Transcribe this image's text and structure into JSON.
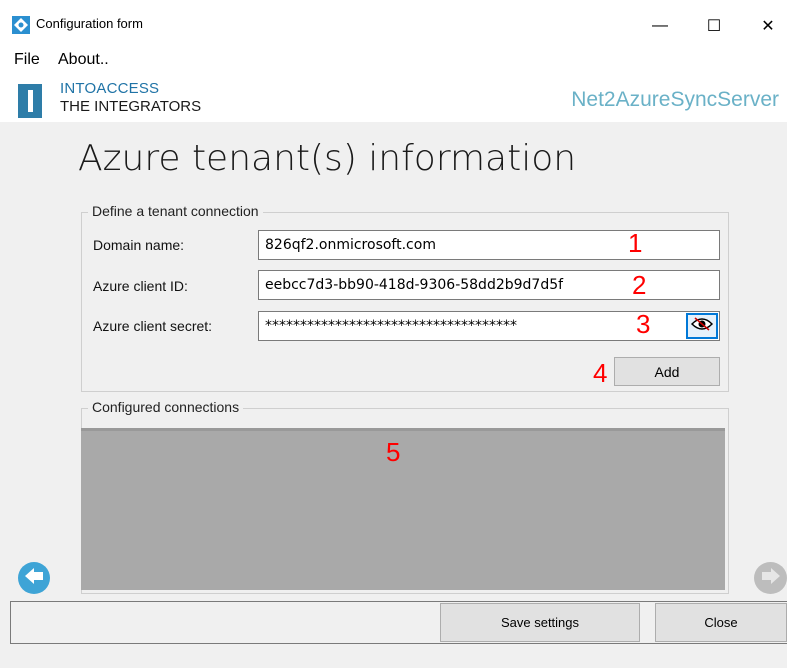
{
  "window": {
    "title": "Configuration form",
    "minimize": "—",
    "maximize": "☐",
    "close": "✕"
  },
  "menu": {
    "items": [
      "File",
      "About.."
    ]
  },
  "header": {
    "logo_line1": "INTOACCESS",
    "logo_line2": "THE INTEGRATORS",
    "product_name": "Net2AzureSyncServer"
  },
  "page": {
    "title": "Azure tenant(s) information"
  },
  "tenant_group": {
    "label": "Define a tenant connection",
    "fields": [
      {
        "label": "Domain name:",
        "value": "826qf2.onmicrosoft.com",
        "marker": "1"
      },
      {
        "label": "Azure client ID:",
        "value": "eebcc7d3-bb90-418d-9306-58dd2b9d7d5f",
        "marker": "2"
      },
      {
        "label": "Azure client secret:",
        "value": "************************************",
        "marker": "3"
      }
    ],
    "add_label": "Add",
    "add_marker": "4"
  },
  "connections_group": {
    "label": "Configured connections",
    "marker": "5"
  },
  "footer": {
    "save_label": "Save settings",
    "close_label": "Close"
  },
  "colors": {
    "accent": "#1f73a6",
    "product": "#6ab1c7",
    "marker": "#ff0000",
    "list_bg": "#a9a9a9"
  }
}
